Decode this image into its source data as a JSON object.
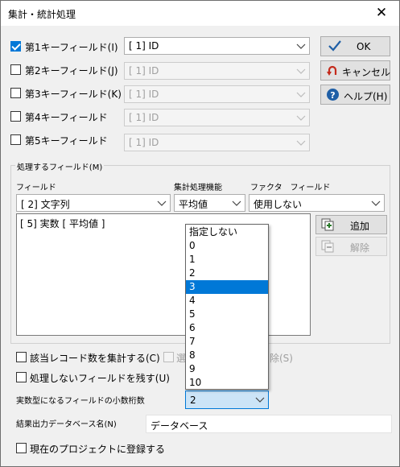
{
  "window": {
    "title": "集計・統計処理",
    "close_glyph": "✕"
  },
  "key_fields": [
    {
      "label": "第1キーフィールド(I)",
      "checked": true,
      "value": "[ 1] ID",
      "enabled": true
    },
    {
      "label": "第2キーフィールド(J)",
      "checked": false,
      "value": "[ 1] ID",
      "enabled": false
    },
    {
      "label": "第3キーフィールド(K)",
      "checked": false,
      "value": "[ 1] ID",
      "enabled": false
    },
    {
      "label": "第4キーフィールド",
      "checked": false,
      "value": "[ 1] ID",
      "enabled": false
    },
    {
      "label": "第5キーフィールド",
      "checked": false,
      "value": "[ 1] ID",
      "enabled": false
    }
  ],
  "buttons": {
    "ok": {
      "label": "OK",
      "icon": "checkmark-icon"
    },
    "cancel": {
      "label": "キャンセル",
      "icon": "undo-arrow-icon"
    },
    "help": {
      "label": "ヘルプ(H)",
      "icon": "help-icon"
    },
    "add": {
      "label": "追加",
      "icon": "add-field-icon"
    },
    "remove": {
      "label": "解除",
      "icon": "remove-field-icon"
    }
  },
  "process_group": {
    "title": "処理するフィールド(M)",
    "field_header": "フィールド",
    "function_header": "集計処理機能",
    "factor_header": "ファクタ　フィールド",
    "field_value": "[ 2] 文字列",
    "function_value": "平均値",
    "factor_value": "使用しない",
    "list_items": [
      "[ 5] 実数 [ 平均値 ]"
    ]
  },
  "options": {
    "count_records": "該当レコード数を集計する(C)",
    "count_records_checked": false,
    "select_partial": "選",
    "select_suffix": "除(S)",
    "keep_unprocessed": "処理しないフィールドを残す(U)",
    "keep_unprocessed_checked": false,
    "decimals_label": "実数型になるフィールドの小数桁数",
    "decimals_value": "2",
    "decimals_options": [
      "指定しない",
      "0",
      "1",
      "2",
      "3",
      "4",
      "5",
      "6",
      "7",
      "8",
      "9",
      "10"
    ],
    "decimals_highlighted": "3",
    "output_db_label": "結果出力データベース名(N)",
    "output_db_value": "データベース",
    "register_project": "現在のプロジェクトに登録する",
    "register_project_checked": false
  },
  "colors": {
    "accent": "#0078d7",
    "focus_bg": "#cce4f7",
    "cancel_red": "#c42b1c",
    "help_blue": "#1f5fa6"
  }
}
